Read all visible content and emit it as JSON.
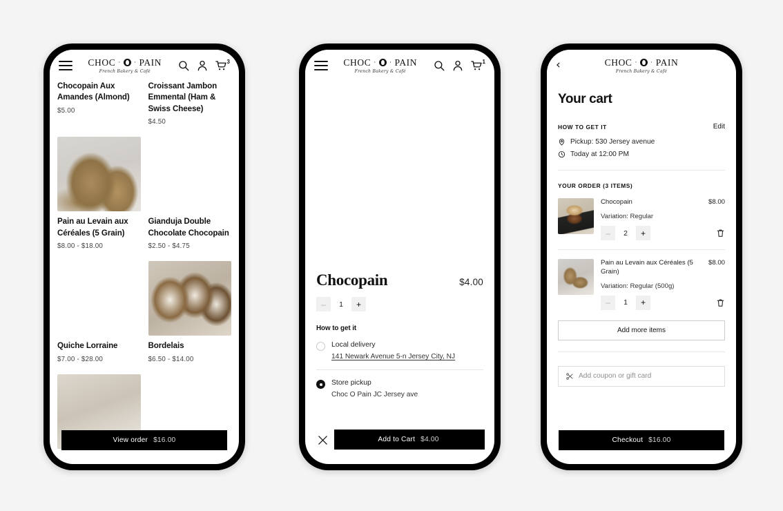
{
  "brand": {
    "name_line": "CHOC · PAIN",
    "name_left": "CHOC",
    "name_right": "PAIN",
    "tagline": "French Bakery & Café"
  },
  "phone1": {
    "header": {
      "menu_icon": "hamburger-icon",
      "search_icon": "search-icon",
      "account_icon": "person-icon",
      "cart_icon": "cart-icon",
      "cart_count": "3"
    },
    "products": [
      {
        "name": "Chocopain Aux Amandes (Almond)",
        "price": "$5.00",
        "has_image": false
      },
      {
        "name": "Croissant Jambon Emmental (Ham & Swiss Cheese)",
        "price": "$4.50",
        "has_image": false
      },
      {
        "name": "Pain au Levain aux Céréales (5 Grain)",
        "price": "$8.00  -  $18.00",
        "has_image": true
      },
      {
        "name": "Gianduja Double Chocolate Chocopain",
        "price": "$2.50  -  $4.75",
        "has_image": true
      },
      {
        "name": "Quiche Lorraine",
        "price": "$7.00  -  $28.00",
        "has_image": true
      },
      {
        "name": "Bordelais",
        "price": "$6.50  -  $14.00",
        "has_image": true
      }
    ],
    "bottom_bar": {
      "label": "View order",
      "amount": "$16.00"
    }
  },
  "phone2": {
    "header": {
      "menu_icon": "hamburger-icon",
      "search_icon": "search-icon",
      "account_icon": "person-icon",
      "cart_icon": "cart-icon",
      "cart_count": "1"
    },
    "product": {
      "title": "Chocopain",
      "price": "$4.00",
      "quantity": "1",
      "decrement_label": "–",
      "increment_label": "+"
    },
    "how_to_get_it": {
      "heading": "How to get it",
      "options": [
        {
          "label": "Local delivery",
          "detail": "141 Newark Avenue 5-n Jersey City, NJ",
          "selected": false
        },
        {
          "label": "Store pickup",
          "detail": "Choc O Pain JC Jersey ave",
          "selected": true
        }
      ]
    },
    "close_icon": "close-icon",
    "bottom_bar": {
      "label": "Add to Cart",
      "amount": "$4.00"
    }
  },
  "phone3": {
    "header": {
      "back_icon": "back-chevron-icon"
    },
    "title": "Your cart",
    "how_to_get_it": {
      "label": "HOW TO GET IT",
      "edit_label": "Edit",
      "pickup_icon": "location-pin-icon",
      "pickup": "Pickup: 530 Jersey avenue",
      "time_icon": "clock-icon",
      "time": "Today at 12:00 PM"
    },
    "order_label": "YOUR ORDER (3 ITEMS)",
    "items": [
      {
        "name": "Chocopain",
        "price": "$8.00",
        "variation": "Variation: Regular",
        "quantity": "2",
        "decrement_label": "–",
        "increment_label": "+",
        "delete_icon": "trash-icon"
      },
      {
        "name": "Pain au Levain aux Céréales (5 Grain)",
        "price": "$8.00",
        "variation": "Variation: Regular (500g)",
        "quantity": "1",
        "decrement_label": "–",
        "increment_label": "+",
        "delete_icon": "trash-icon"
      }
    ],
    "add_more_label": "Add more items",
    "coupon": {
      "icon": "coupon-scissors-icon",
      "placeholder": "Add coupon or gift card"
    },
    "bottom_bar": {
      "label": "Checkout",
      "amount": "$16.00"
    }
  },
  "colors": {
    "page_background": "#f4f4f4",
    "bar_black": "#000000",
    "text_primary": "#111111",
    "text_muted": "#8e8e8e"
  }
}
